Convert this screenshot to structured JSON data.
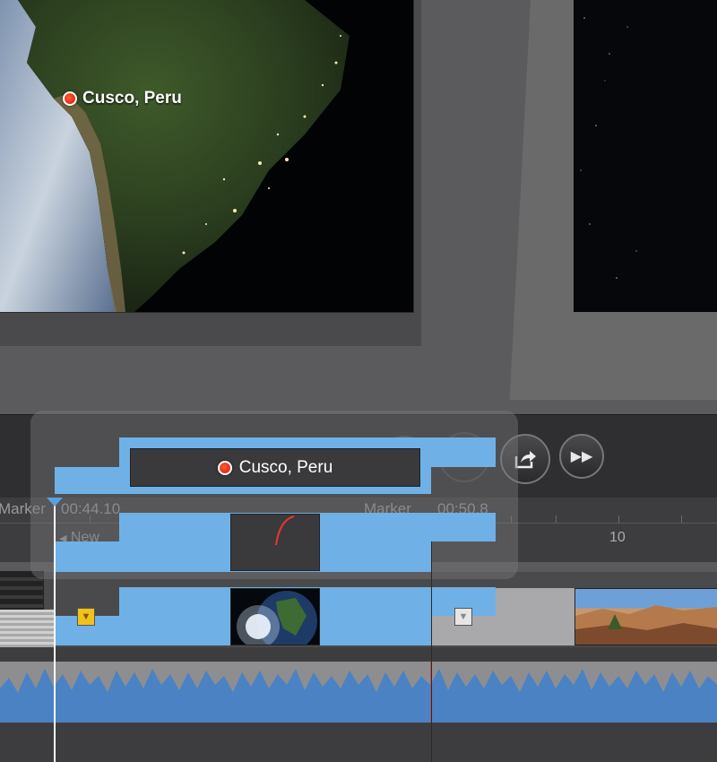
{
  "viewer": {
    "location_label": "Cusco, Peru"
  },
  "title_clip": {
    "text": "Cusco, Peru"
  },
  "transport": {
    "rewind_icon": "rewind-icon",
    "share_icon": "share-icon",
    "forward_icon": "fast-forward-icon"
  },
  "ruler": {
    "marker_left": "Marker",
    "time_left": "00:44.10",
    "marker_right": "Marker",
    "time_right": "00:50.8",
    "new_label": "New",
    "second_mark": "10"
  },
  "colors": {
    "selection_blue": "#6fb1e6",
    "marker_yellow": "#f2c21a",
    "marker_white": "#e6e6e6",
    "playhead": "#ffffff",
    "audio_wave": "#4a82c4"
  }
}
